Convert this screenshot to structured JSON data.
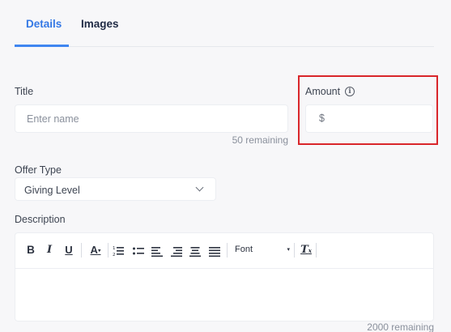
{
  "tabs": {
    "details": "Details",
    "images": "Images"
  },
  "title_field": {
    "label": "Title",
    "placeholder": "Enter name",
    "remaining": "50 remaining"
  },
  "amount_field": {
    "label": "Amount",
    "info_icon": "i",
    "currency": "$",
    "value": ""
  },
  "offer_type": {
    "label": "Offer Type",
    "selected": "Giving Level"
  },
  "description": {
    "label": "Description",
    "toolbar": {
      "bold": "B",
      "italic": "I",
      "underline": "U",
      "font_color": "A",
      "font_label": "Font",
      "clear_format": "T"
    },
    "remaining": "2000 remaining"
  },
  "colors": {
    "accent": "#3f86f0",
    "highlight": "#d9262b"
  },
  "icons": [
    "info-icon",
    "chevron-down-icon",
    "bold-icon",
    "italic-icon",
    "underline-icon",
    "font-color-icon",
    "numbered-list-icon",
    "bullet-list-icon",
    "align-left-icon",
    "align-right-icon",
    "align-center-icon",
    "align-justify-icon",
    "clear-format-icon"
  ]
}
